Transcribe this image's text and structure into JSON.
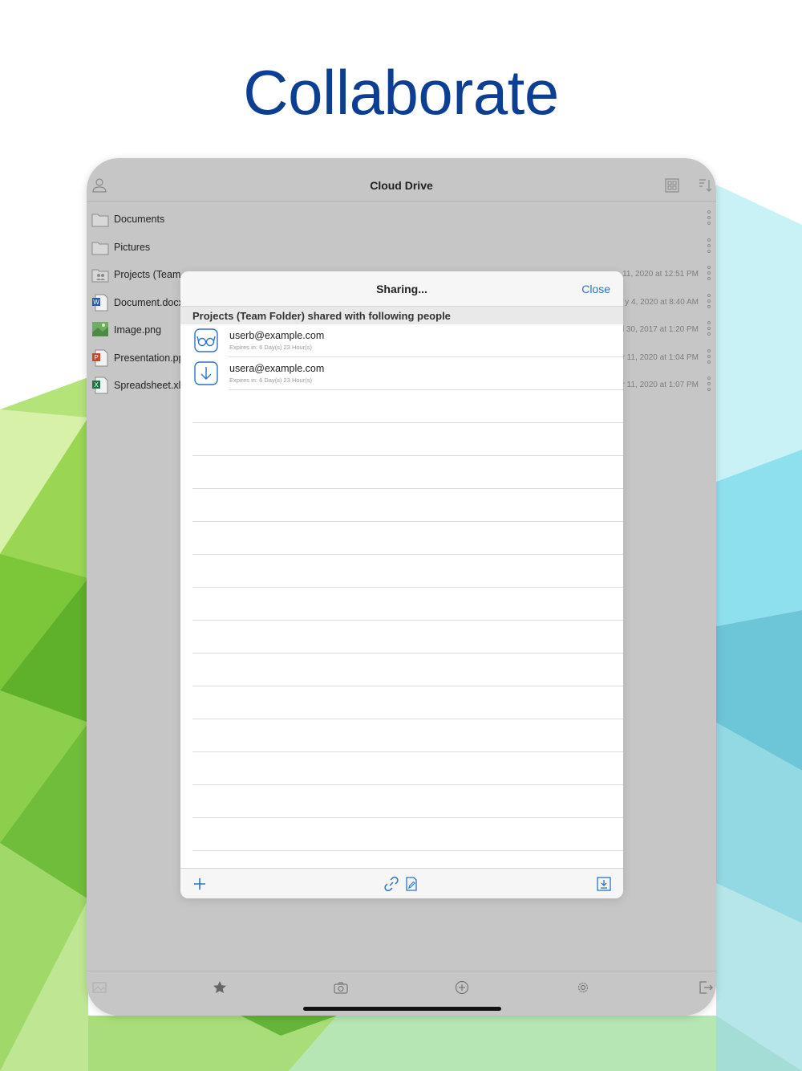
{
  "headline": "Collaborate",
  "colors": {
    "headline": "#0c3f94",
    "accent": "#2b74c9",
    "green": "#8bd44a",
    "cyan": "#8fe0ef"
  },
  "navbar": {
    "title": "Cloud Drive",
    "icons": [
      "user-icon",
      "grid-view-icon",
      "sort-icon"
    ]
  },
  "files": [
    {
      "name": "Documents",
      "date": "",
      "icon": "folder-icon"
    },
    {
      "name": "Pictures",
      "date": "",
      "icon": "folder-icon"
    },
    {
      "name": "Projects (Team",
      "date": "11, 2020 at 12:51 PM",
      "icon": "team-folder-icon"
    },
    {
      "name": "Document.docx",
      "date": "y 4, 2020 at 8:40 AM",
      "icon": "word-file-icon"
    },
    {
      "name": "Image.png",
      "date": "l 30, 2017 at 1:20 PM",
      "icon": "image-file-icon"
    },
    {
      "name": "Presentation.pp",
      "date": "r 11, 2020 at 1:04 PM",
      "icon": "powerpoint-file-icon"
    },
    {
      "name": "Spreadsheet.xls",
      "date": "ar 11, 2020 at 1:07 PM",
      "icon": "excel-file-icon"
    }
  ],
  "sharing": {
    "title": "Sharing...",
    "close_label": "Close",
    "section_header": "Projects (Team Folder) shared with following people",
    "people": [
      {
        "email": "userb@example.com",
        "expires": "Expires in: 6 Day(s) 23 Hour(s)",
        "icon": "view-only-glasses-icon"
      },
      {
        "email": "usera@example.com",
        "expires": "Expires in: 6 Day(s) 23 Hour(s)",
        "icon": "download-permission-icon"
      }
    ],
    "toolbar_icons": [
      "add-icon",
      "link-icon",
      "edit-file-icon",
      "save-icon"
    ]
  },
  "tabbar": {
    "icons": [
      "photos-icon",
      "favorites-star-icon",
      "camera-icon",
      "add-circle-icon",
      "settings-gear-icon",
      "logout-icon"
    ]
  }
}
